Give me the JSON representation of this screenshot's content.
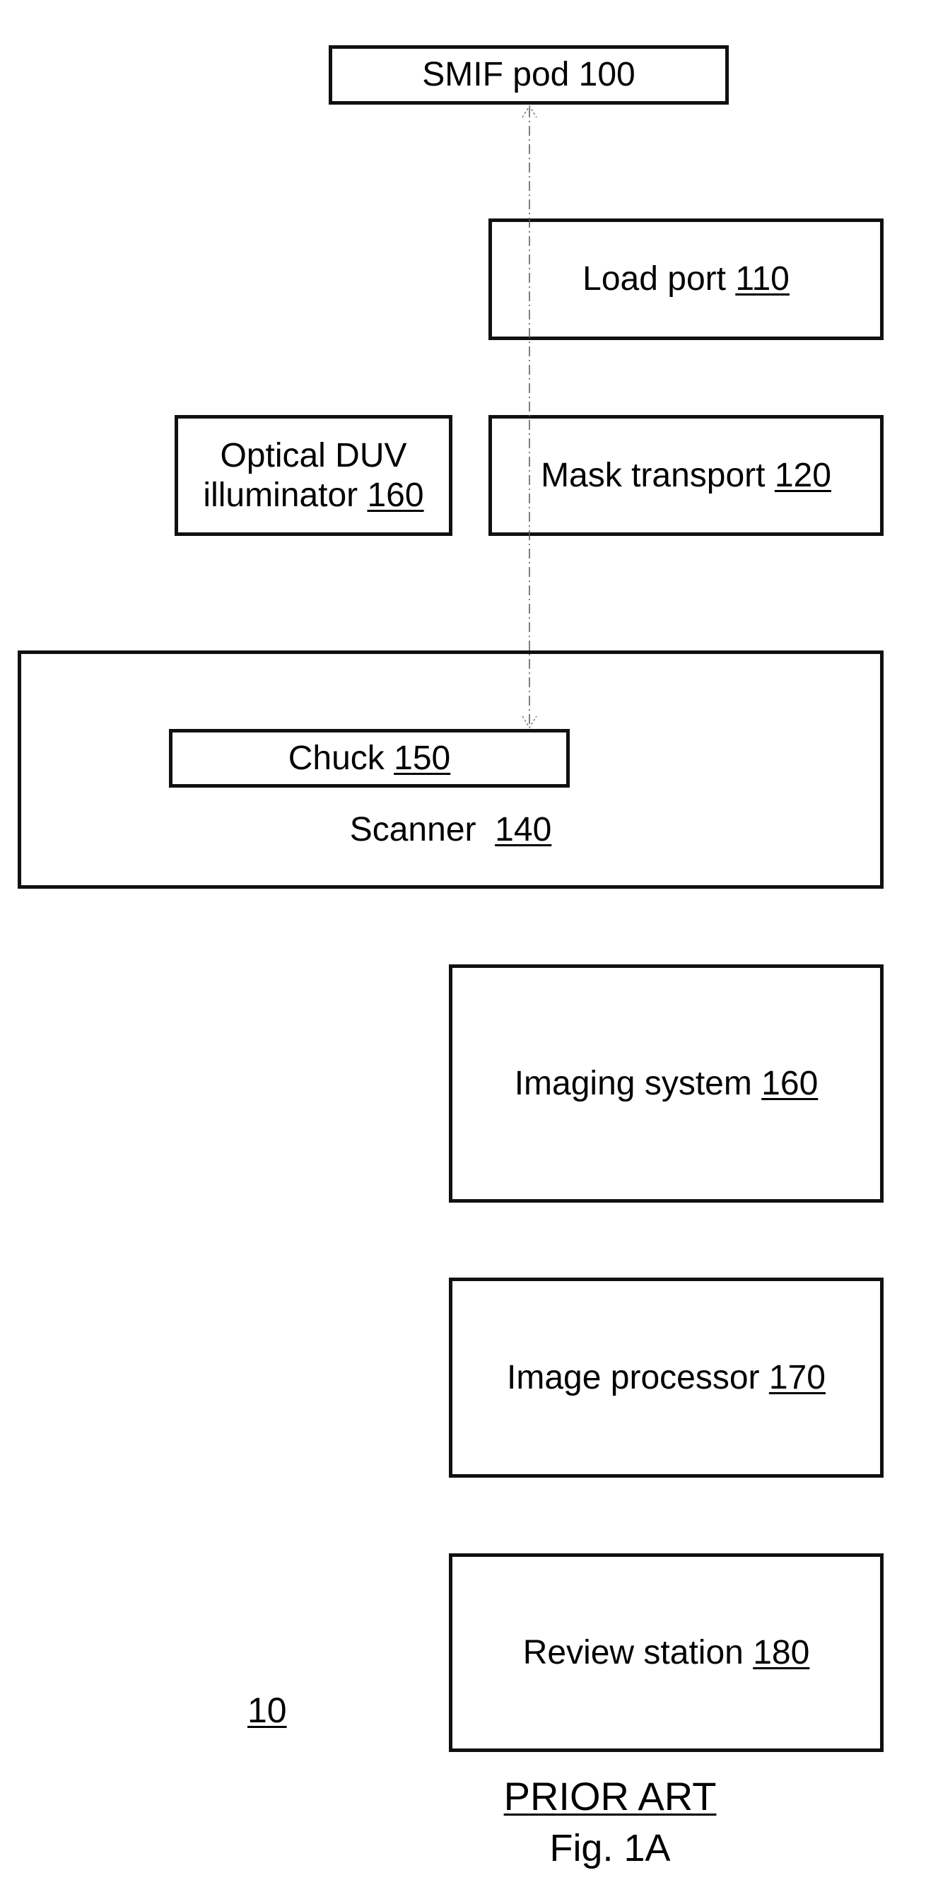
{
  "figure": {
    "system_ref": "10",
    "caption_status": "PRIOR ART",
    "caption_figure": "Fig. 1A"
  },
  "blocks": {
    "smif_pod": {
      "label": "SMIF pod 100",
      "ref": ""
    },
    "load_port": {
      "label": "Load port ",
      "ref": "110"
    },
    "optical_duv_illuminator": {
      "label_line1": "Optical DUV",
      "label_line2": "illuminator ",
      "ref": "160"
    },
    "mask_transport": {
      "label": "Mask transport ",
      "ref": "120"
    },
    "scanner": {
      "label": "Scanner  ",
      "ref": "140"
    },
    "chuck": {
      "label": "Chuck ",
      "ref": "150"
    },
    "imaging_system": {
      "label": "Imaging system ",
      "ref": "160"
    },
    "image_processor": {
      "label": "Image processor ",
      "ref": "170"
    },
    "review_station": {
      "label": "Review station ",
      "ref": "180"
    }
  },
  "connectors": [
    {
      "from": "SMIF pod 100",
      "to": "Chuck 150",
      "style": "dashed",
      "arrowheads": "both"
    }
  ]
}
